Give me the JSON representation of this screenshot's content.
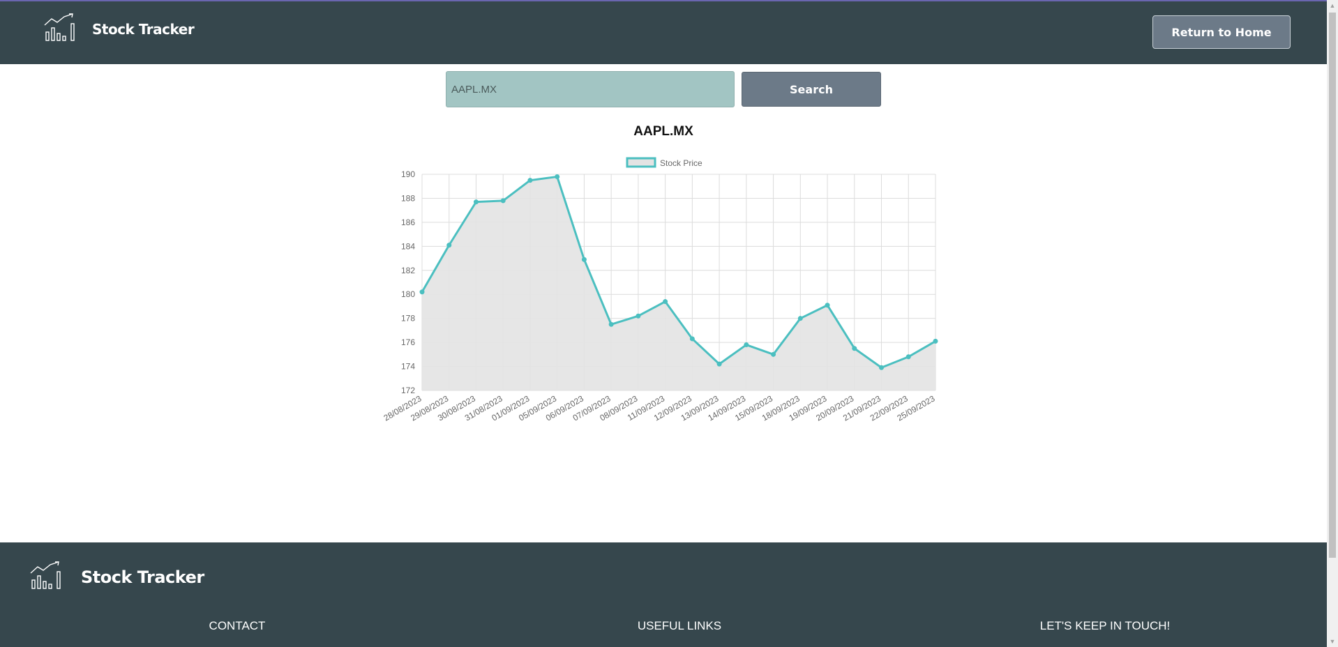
{
  "header": {
    "brand_name": "Stock Tracker",
    "logo_icon": "chart-trend-icon",
    "home_button_label": "Return to Home"
  },
  "search": {
    "value": "AAPL.MX",
    "button_label": "Search"
  },
  "colors": {
    "navbar_bg": "#36474d",
    "button_bg": "#6c7a88",
    "input_bg": "#a2c5c3",
    "line_color": "#4bbfc0",
    "area_fill": "#e3e3e3"
  },
  "chart_data": {
    "type": "area",
    "title": "AAPL.MX",
    "legend_position": "top-center",
    "grid": true,
    "categories": [
      "28/08/2023",
      "29/08/2023",
      "30/08/2023",
      "31/08/2023",
      "01/09/2023",
      "05/09/2023",
      "06/09/2023",
      "07/09/2023",
      "08/09/2023",
      "11/09/2023",
      "12/09/2023",
      "13/09/2023",
      "14/09/2023",
      "15/09/2023",
      "18/09/2023",
      "19/09/2023",
      "20/09/2023",
      "21/09/2023",
      "22/09/2023",
      "25/09/2023"
    ],
    "series": [
      {
        "name": "Stock Price",
        "values": [
          180.2,
          184.1,
          187.7,
          187.8,
          189.5,
          189.8,
          182.9,
          177.5,
          178.2,
          179.4,
          176.3,
          174.2,
          175.8,
          175.0,
          178.0,
          179.1,
          175.5,
          173.9,
          174.8,
          176.1
        ]
      }
    ],
    "ylim": [
      172,
      190
    ],
    "yticks": [
      "190",
      "188",
      "186",
      "184",
      "182",
      "180",
      "178",
      "176",
      "174",
      "172"
    ]
  },
  "footer": {
    "brand_name": "Stock Tracker",
    "contact_heading": "CONTACT",
    "links_heading": "USEFUL LINKS",
    "touch_heading": "LET'S KEEP IN TOUCH!"
  }
}
